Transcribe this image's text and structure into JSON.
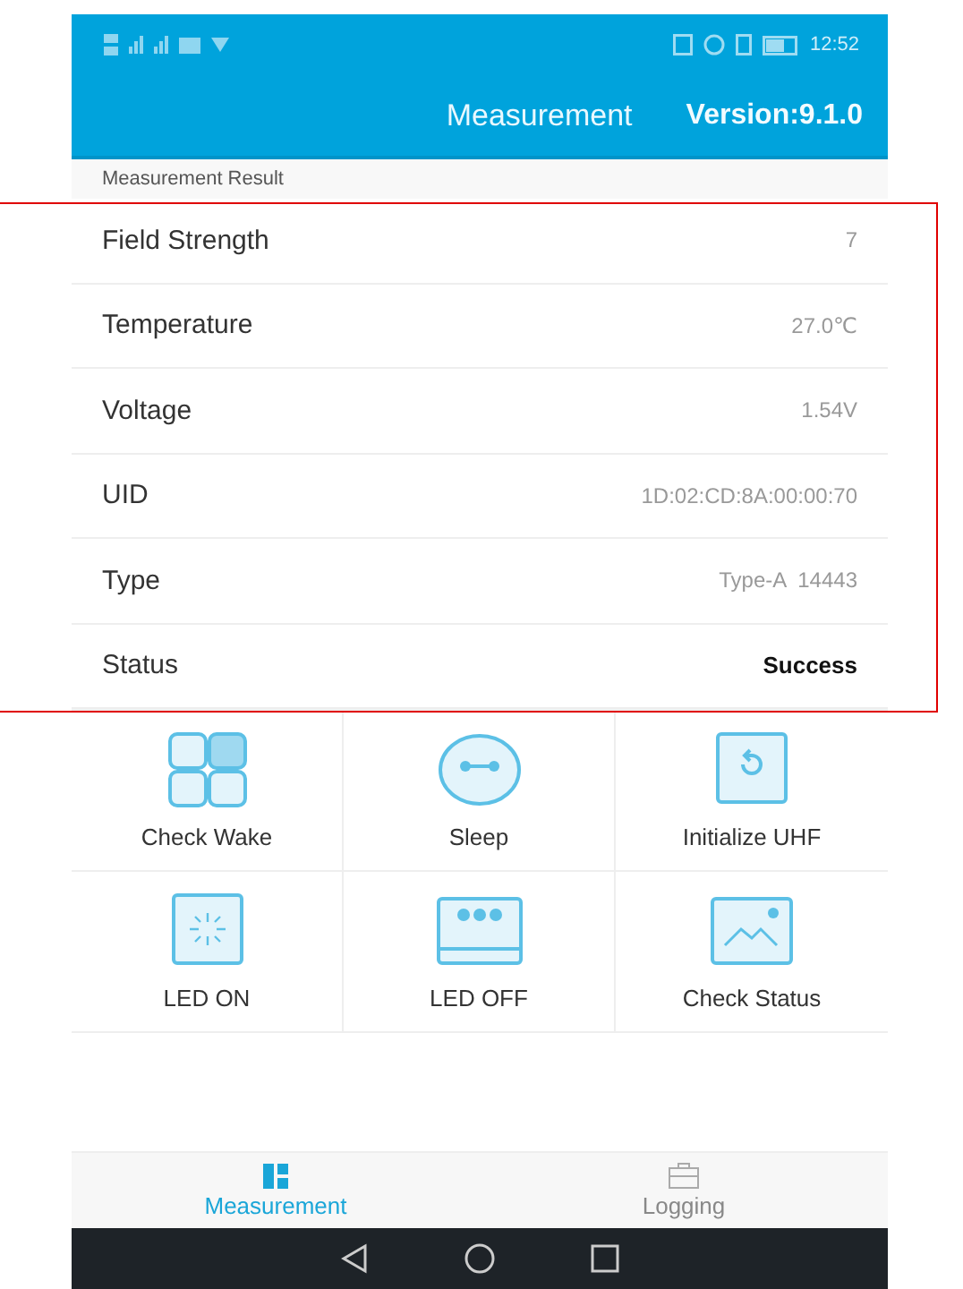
{
  "status_bar": {
    "time": "12:52"
  },
  "header": {
    "title": "Measurement",
    "version": "Version:9.1.0"
  },
  "section_label": "Measurement Result",
  "results": [
    {
      "label": "Field Strength",
      "value": "7",
      "kind": "plain"
    },
    {
      "label": "Temperature",
      "value": "27.0℃",
      "kind": "plain"
    },
    {
      "label": "Voltage",
      "value": "1.54V",
      "kind": "plain"
    },
    {
      "label": "UID",
      "value": "1D:02:CD:8A:00:00:70",
      "kind": "plain"
    },
    {
      "label": "Type",
      "value": "Type-A  14443",
      "kind": "plain"
    },
    {
      "label": "Status",
      "value": "Success",
      "kind": "strong"
    }
  ],
  "actions": [
    {
      "label": "Check Wake",
      "kind": "grid"
    },
    {
      "label": "Sleep",
      "kind": "sleep"
    },
    {
      "label": "Initialize UHF",
      "kind": "refresh"
    },
    {
      "label": "LED ON",
      "kind": "spark"
    },
    {
      "label": "LED OFF",
      "kind": "dots"
    },
    {
      "label": "Check Status",
      "kind": "image"
    }
  ],
  "tabs": [
    {
      "label": "Measurement",
      "selected": true,
      "kind": "grid"
    },
    {
      "label": "Logging",
      "selected": false,
      "kind": "case"
    }
  ]
}
